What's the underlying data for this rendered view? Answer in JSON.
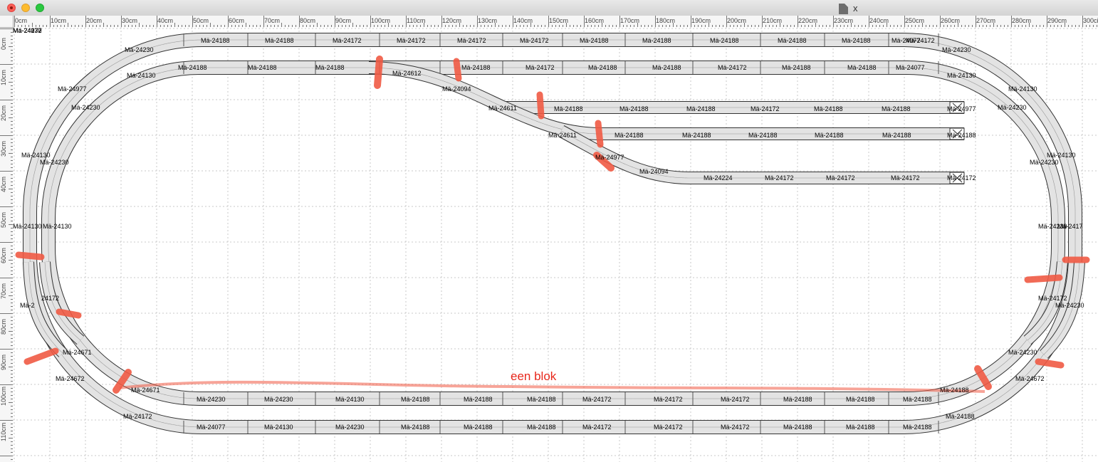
{
  "window": {
    "title": "x",
    "buttons": {
      "close": "close",
      "minimize": "minimize",
      "zoom": "zoom"
    }
  },
  "ruler_h": [
    "0cm",
    "10cm",
    "20cm",
    "30cm",
    "40cm",
    "50cm",
    "60cm",
    "70cm",
    "80cm",
    "90cm",
    "100cm",
    "110cm",
    "120cm",
    "130cm",
    "140cm",
    "150cm",
    "160cm",
    "170cm",
    "180cm",
    "190cm",
    "200cm",
    "210cm",
    "220cm",
    "230cm",
    "240cm",
    "250cm",
    "260cm",
    "270cm",
    "280cm",
    "290cm",
    "300ci"
  ],
  "ruler_v": [
    "0cm",
    "10cm",
    "20cm",
    "30cm",
    "40cm",
    "50cm",
    "60cm",
    "70cm",
    "80cm",
    "90cm",
    "100cm",
    "110cm"
  ],
  "colors": {
    "track_fill": "#e3e3e3",
    "track_line": "#333333",
    "marker": "#f05a44",
    "annotation": "#e8281c",
    "grid": "#c9c9c9"
  },
  "annotation": "een blok",
  "track_labels": [
    "Mä-24188",
    "Mä-24188",
    "Mä-24172",
    "Mä-24172",
    "Mä-24172",
    "Mä-24172",
    "Mä-24188",
    "Mä-24188",
    "Mä-24188",
    "Mä-24188",
    "Mä-24188",
    "Mä-24172",
    "Mä-24077",
    "Mä-24230",
    "Mä-24230",
    "Mä-24188",
    "Mä-24188",
    "Mä-24188",
    "Mä-24612",
    "Mä-24188",
    "Mä-24172",
    "Mä-24188",
    "Mä-24188",
    "Mä-24172",
    "Mä-24188",
    "Mä-24188",
    "Mä-24077",
    "Mä-24130",
    "Mä-24130",
    "Mä-24094",
    "Mä-24611",
    "Mä-24188",
    "Mä-24188",
    "Mä-24188",
    "Mä-24172",
    "Mä-24188",
    "Mä-24188",
    "Mä-24977",
    "Mä-24611",
    "Mä-24188",
    "Mä-24188",
    "Mä-24188",
    "Mä-24188",
    "Mä-24188",
    "Mä-24188",
    "Mä-24977",
    "Mä-24094",
    "Mä-24224",
    "Mä-24172",
    "Mä-24172",
    "Mä-24172",
    "Mä-24172",
    "Mä-24977",
    "Mä-24230",
    "Mä-24130",
    "Mä-24230",
    "Mä-24130",
    "Mä-24230",
    "Mä-24130",
    "Mä-24230",
    "Mä-24130",
    "Mä-24130",
    "Mä-24230",
    "Mä-2417",
    "24172",
    "Mä-2",
    "Mä-24172",
    "Mä-24230",
    "Mä-24671",
    "Mä-24230",
    "Mä-24672",
    "Mä-24672",
    "Mä-24671",
    "Mä-24230",
    "Mä-24230",
    "Mä-24130",
    "Mä-24188",
    "Mä-24188",
    "Mä-24188",
    "Mä-24172",
    "Mä-24172",
    "Mä-24172",
    "Mä-24188",
    "Mä-24188",
    "Mä-24188",
    "Mä-24188",
    "Mä-24172",
    "Mä-24077",
    "Mä-24130",
    "Mä-24230",
    "Mä-24188",
    "Mä-24188",
    "Mä-24188",
    "Mä-24172",
    "Mä-24172",
    "Mä-24172",
    "Mä-24188",
    "Mä-24188",
    "Mä-24188",
    "Mä-24188",
    "Mä-24172",
    "Mä-24077",
    "Mä-24230"
  ]
}
